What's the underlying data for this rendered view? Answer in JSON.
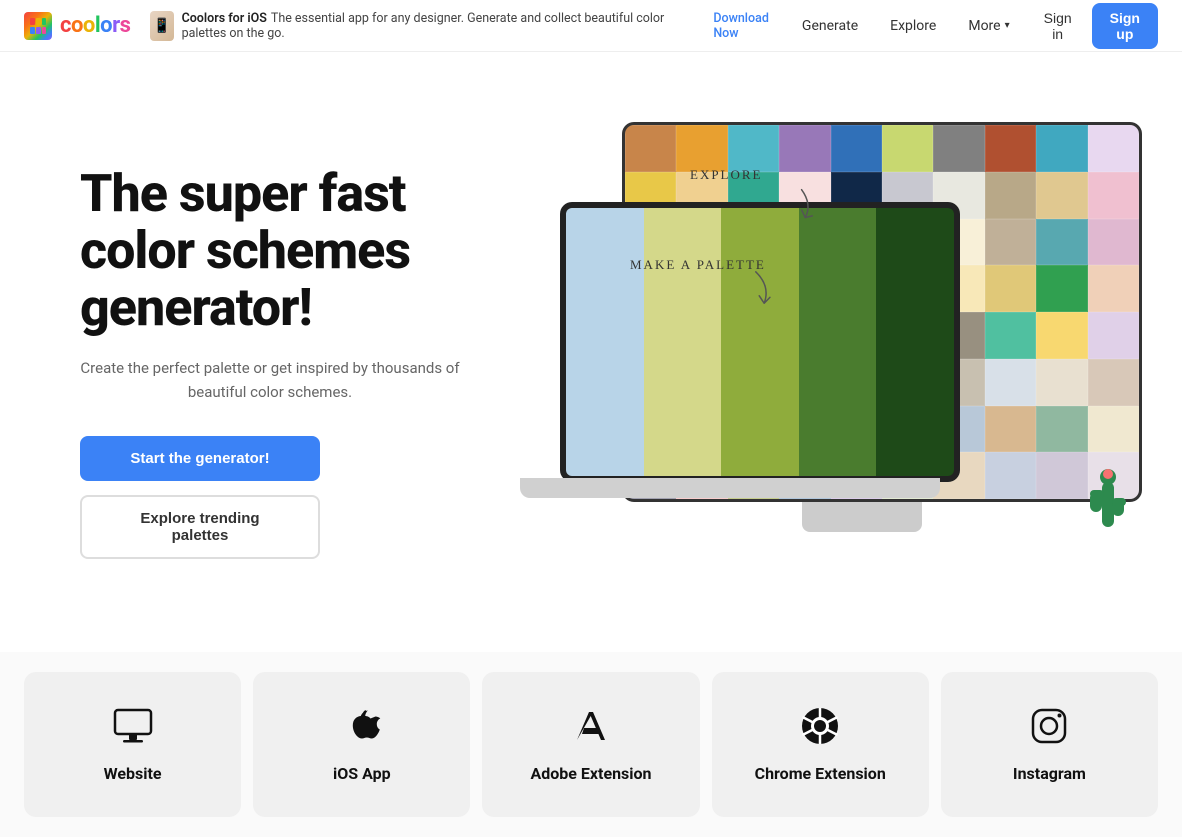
{
  "navbar": {
    "logo_text": "coolors",
    "promo": {
      "icon": "📱",
      "app_name": "Coolors for iOS",
      "description": "The essential app for any designer. Generate and collect beautiful color palettes on the go.",
      "cta": "Download Now"
    },
    "nav_links": [
      {
        "label": "Generate",
        "has_dropdown": false
      },
      {
        "label": "Explore",
        "has_dropdown": false
      },
      {
        "label": "More",
        "has_dropdown": true
      }
    ],
    "signin_label": "Sign in",
    "signup_label": "Sign up"
  },
  "hero": {
    "title": "The super fast color schemes generator!",
    "subtitle": "Create the perfect palette or get inspired by thousands of beautiful color schemes.",
    "cta_primary": "Start the generator!",
    "cta_secondary": "Explore trending palettes",
    "label_explore": "EXPLORE",
    "label_palette": "MAKE A PALETTE"
  },
  "palette_colors": [
    "#b8d4e8",
    "#d4d88a",
    "#8fac3c",
    "#4a7c2e",
    "#1e4a18"
  ],
  "monitor_colors": [
    "#c8854a",
    "#e8a030",
    "#50b8c8",
    "#9878b8",
    "#3070b8",
    "#c8d870",
    "#808080",
    "#b05030",
    "#40a8c0",
    "#e8d8f0",
    "#e8c848",
    "#f0d090",
    "#30a890",
    "#f8e0e0",
    "#102848",
    "#c8c8d0",
    "#e8e8e0",
    "#b8a888",
    "#e0c890",
    "#f0c0d0",
    "#e08070",
    "#d8e8c0",
    "#286878",
    "#f8f0e0",
    "#484848",
    "#808890",
    "#f8f0d8",
    "#c0b098",
    "#58a8b0",
    "#e0b8d0",
    "#202828",
    "#e8f0e0",
    "#f0e0a0",
    "#f05030",
    "#707060",
    "#d8d0c0",
    "#f8e8b8",
    "#e0c878",
    "#30a050",
    "#f0d0b8",
    "#d0d8f0",
    "#e8e050",
    "#a040a0",
    "#e06828",
    "#d0d8e0",
    "#f8c040",
    "#989080",
    "#50c0a0",
    "#f8d870",
    "#e0d0e8",
    "#3858a0",
    "#e8e8a0",
    "#c8a858",
    "#d03030",
    "#b0b8c8",
    "#e8c8a0",
    "#c8c0b0",
    "#d8e0e8",
    "#e8e0d0",
    "#d8c8b8",
    "#e0a0c0",
    "#c0d8f0",
    "#b0d8c0",
    "#e8d0a8",
    "#787060",
    "#e0e0c8",
    "#b8c8d8",
    "#d8b890",
    "#90b8a0",
    "#f0e8d0",
    "#9898a8",
    "#f8c8c8",
    "#c0c880",
    "#a8c0d8",
    "#d8c8e8",
    "#e0e8d0",
    "#e8d8c0",
    "#c8d0e0",
    "#d0c8d8",
    "#e8e0e8"
  ],
  "cards": [
    {
      "id": "website",
      "label": "Website",
      "icon_type": "monitor"
    },
    {
      "id": "ios",
      "label": "iOS App",
      "icon_type": "apple"
    },
    {
      "id": "adobe",
      "label": "Adobe Extension",
      "icon_type": "adobe"
    },
    {
      "id": "chrome",
      "label": "Chrome Extension",
      "icon_type": "chrome"
    },
    {
      "id": "instagram",
      "label": "Instagram",
      "icon_type": "instagram"
    }
  ]
}
